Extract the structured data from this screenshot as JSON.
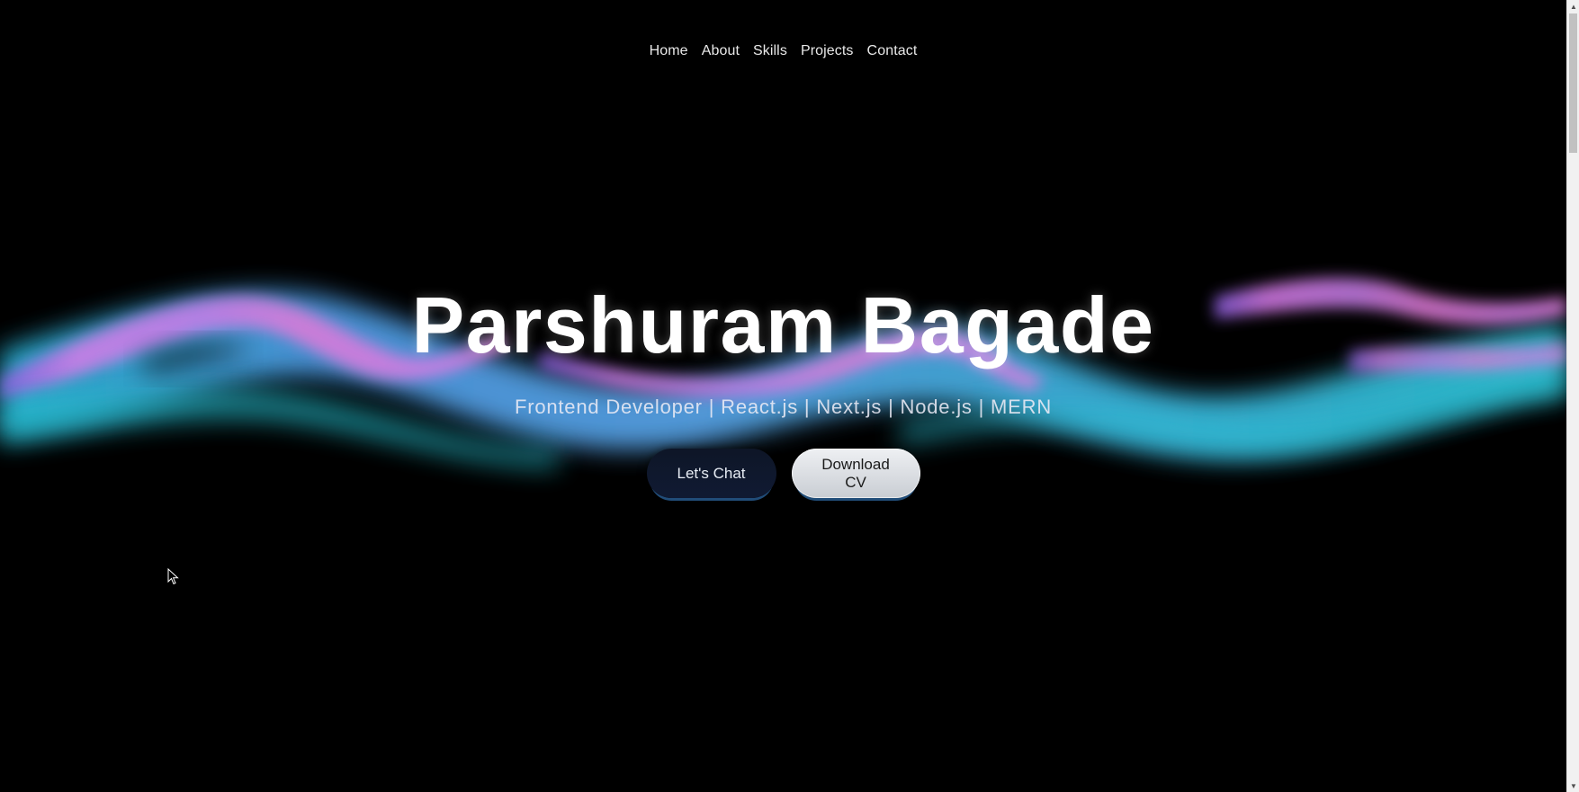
{
  "nav": {
    "items": [
      {
        "label": "Home"
      },
      {
        "label": "About"
      },
      {
        "label": "Skills"
      },
      {
        "label": "Projects"
      },
      {
        "label": "Contact"
      }
    ]
  },
  "hero": {
    "title": "Parshuram Bagade",
    "subtitle": "Frontend Developer | React.js | Next.js | Node.js | MERN",
    "buttons": {
      "chat_label": "Let's Chat",
      "cv_label": "Download CV"
    }
  },
  "colors": {
    "background": "#000000",
    "wave_blue": "#4aa8e8",
    "wave_pink": "#d97ae6",
    "wave_cyan": "#2ec4d6"
  },
  "icons": {
    "cursor": "mouse-pointer-icon",
    "scroll_up": "triangle-up-icon",
    "scroll_down": "triangle-down-icon"
  }
}
